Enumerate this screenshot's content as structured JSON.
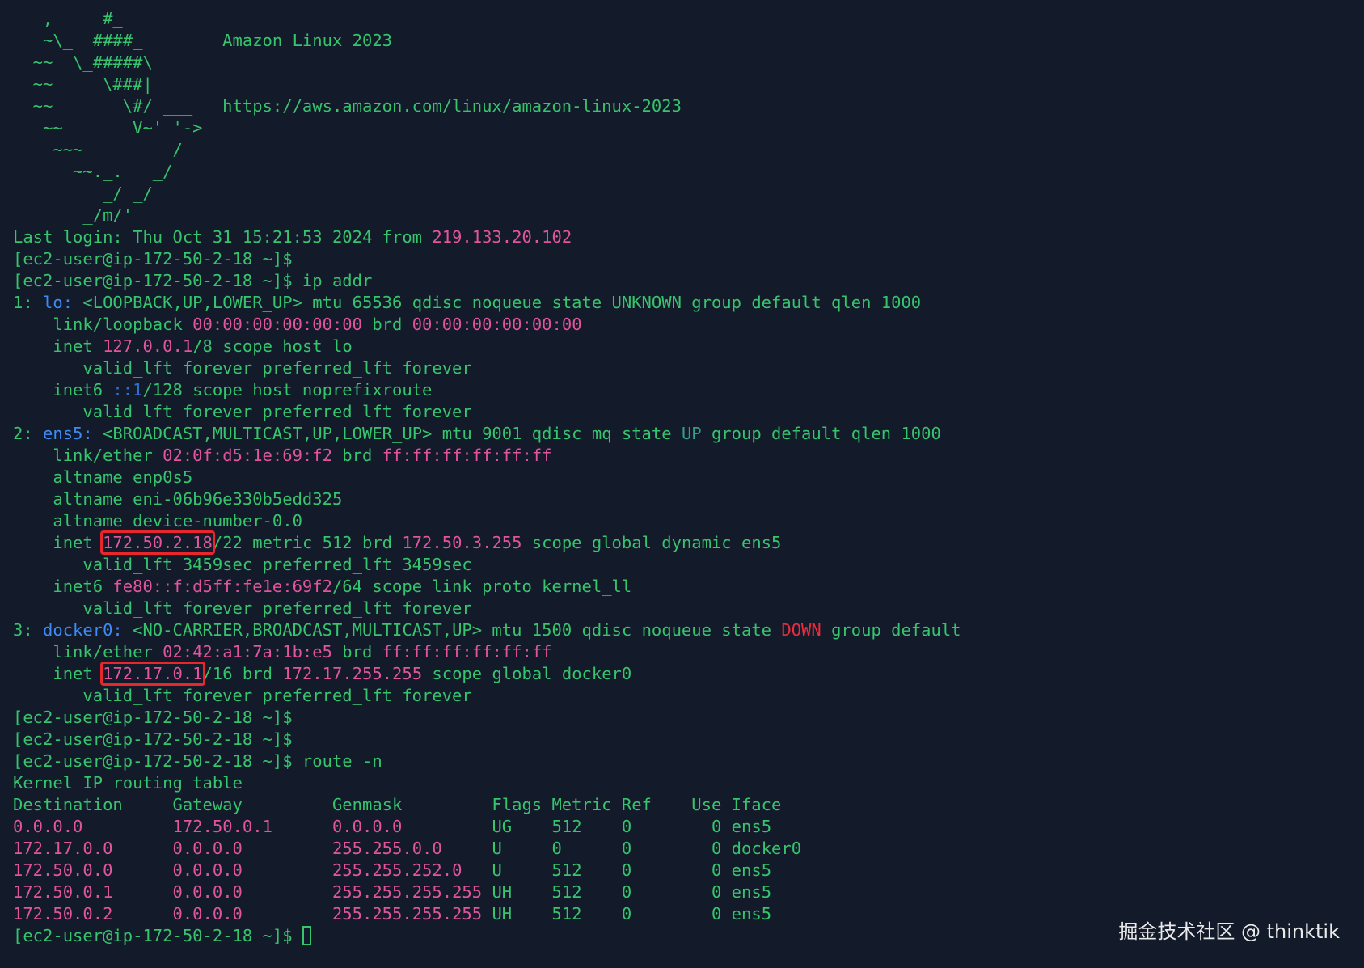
{
  "colors": {
    "background": "#131a2a",
    "text_green": "#36c46d",
    "text_pink": "#e0559b",
    "text_blue": "#3d8bf5",
    "text_red": "#f02a3c",
    "highlight_box": "#e8262b"
  },
  "terminal": {
    "lines": [
      [
        {
          "t": "   ,     #_",
          "c": "g"
        }
      ],
      [
        {
          "t": "   ~\\_  ####_        Amazon Linux 2023",
          "c": "g"
        }
      ],
      [
        {
          "t": "  ~~  \\_#####\\",
          "c": "g"
        }
      ],
      [
        {
          "t": "  ~~     \\###|",
          "c": "g"
        }
      ],
      [
        {
          "t": "  ~~       \\#/ ___   https://aws.amazon.com/linux/amazon-linux-2023",
          "c": "g"
        }
      ],
      [
        {
          "t": "   ~~       V~' '->",
          "c": "g"
        }
      ],
      [
        {
          "t": "    ~~~         /",
          "c": "g"
        }
      ],
      [
        {
          "t": "      ~~._.   _/",
          "c": "g"
        }
      ],
      [
        {
          "t": "         _/ _/",
          "c": "g"
        }
      ],
      [
        {
          "t": "       _/m/'",
          "c": "g"
        }
      ],
      [
        {
          "t": "Last login: Thu Oct 31 15:21:53 2024 from ",
          "c": "g"
        },
        {
          "t": "219.133.20.102",
          "c": "p"
        }
      ],
      [
        {
          "t": "[ec2-user@ip-172-50-2-18 ~]$",
          "c": "g"
        }
      ],
      [
        {
          "t": "[ec2-user@ip-172-50-2-18 ~]$ ip addr",
          "c": "g"
        }
      ],
      [
        {
          "t": "1: ",
          "c": "g"
        },
        {
          "t": "lo:",
          "c": "b"
        },
        {
          "t": " <LOOPBACK,UP,LOWER_UP> mtu 65536 qdisc noqueue state UNKNOWN group default qlen 1000",
          "c": "g"
        }
      ],
      [
        {
          "t": "    link/loopback ",
          "c": "g"
        },
        {
          "t": "00:00:00:00:00:00",
          "c": "p"
        },
        {
          "t": " brd ",
          "c": "g"
        },
        {
          "t": "00:00:00:00:00:00",
          "c": "p"
        }
      ],
      [
        {
          "t": "    inet ",
          "c": "g"
        },
        {
          "t": "127.0.0.1",
          "c": "p"
        },
        {
          "t": "/8 scope host lo",
          "c": "g"
        }
      ],
      [
        {
          "t": "       valid_lft forever preferred_lft forever",
          "c": "g"
        }
      ],
      [
        {
          "t": "    inet6 ",
          "c": "g"
        },
        {
          "t": "::1",
          "c": "k"
        },
        {
          "t": "/128 scope host noprefixroute",
          "c": "g"
        }
      ],
      [
        {
          "t": "       valid_lft forever preferred_lft forever",
          "c": "g"
        }
      ],
      [
        {
          "t": "2: ",
          "c": "g"
        },
        {
          "t": "ens5:",
          "c": "b"
        },
        {
          "t": " <BROADCAST,MULTICAST,UP,LOWER_UP> mtu 9001 qdisc mq state ",
          "c": "g"
        },
        {
          "t": "UP",
          "c": "t"
        },
        {
          "t": " group default qlen 1000",
          "c": "g"
        }
      ],
      [
        {
          "t": "    link/ether ",
          "c": "g"
        },
        {
          "t": "02:0f:d5:1e:69:f2",
          "c": "p"
        },
        {
          "t": " brd ",
          "c": "g"
        },
        {
          "t": "ff:ff:ff:ff:ff:ff",
          "c": "p"
        }
      ],
      [
        {
          "t": "    altname enp0s5",
          "c": "g"
        }
      ],
      [
        {
          "t": "    altname eni-06b96e330b5edd325",
          "c": "g"
        }
      ],
      [
        {
          "t": "    altname device-number-0.0",
          "c": "g"
        }
      ],
      [
        {
          "t": "    inet ",
          "c": "g"
        },
        {
          "t": "172.50.2.18",
          "c": "p",
          "hl": true
        },
        {
          "t": "/22 metric 512 brd ",
          "c": "g"
        },
        {
          "t": "172.50.3.255",
          "c": "p"
        },
        {
          "t": " scope global dynamic ens5",
          "c": "g"
        }
      ],
      [
        {
          "t": "       valid_lft 3459sec preferred_lft 3459sec",
          "c": "g"
        }
      ],
      [
        {
          "t": "    inet6 ",
          "c": "g"
        },
        {
          "t": "fe80::f:d5ff:fe1e:69f2",
          "c": "p"
        },
        {
          "t": "/64 scope link proto kernel_ll",
          "c": "g"
        }
      ],
      [
        {
          "t": "       valid_lft forever preferred_lft forever",
          "c": "g"
        }
      ],
      [
        {
          "t": "3: ",
          "c": "g"
        },
        {
          "t": "docker0:",
          "c": "b"
        },
        {
          "t": " <NO-CARRIER,BROADCAST,MULTICAST,UP> mtu 1500 qdisc noqueue state ",
          "c": "g"
        },
        {
          "t": "DOWN",
          "c": "r"
        },
        {
          "t": " group default",
          "c": "g"
        }
      ],
      [
        {
          "t": "    link/ether ",
          "c": "g"
        },
        {
          "t": "02:42:a1:7a:1b:e5",
          "c": "p"
        },
        {
          "t": " brd ",
          "c": "g"
        },
        {
          "t": "ff:ff:ff:ff:ff:ff",
          "c": "p"
        }
      ],
      [
        {
          "t": "    inet ",
          "c": "g"
        },
        {
          "t": "172.17.0.1",
          "c": "p",
          "hl": true
        },
        {
          "t": "/16 brd ",
          "c": "g"
        },
        {
          "t": "172.17.255.255",
          "c": "p"
        },
        {
          "t": " scope global docker0",
          "c": "g"
        }
      ],
      [
        {
          "t": "       valid_lft forever preferred_lft forever",
          "c": "g"
        }
      ],
      [
        {
          "t": "[ec2-user@ip-172-50-2-18 ~]$",
          "c": "g"
        }
      ],
      [
        {
          "t": "[ec2-user@ip-172-50-2-18 ~]$",
          "c": "g"
        }
      ],
      [
        {
          "t": "[ec2-user@ip-172-50-2-18 ~]$ route -n",
          "c": "g"
        }
      ],
      [
        {
          "t": "Kernel IP routing table",
          "c": "g"
        }
      ],
      [
        {
          "t": "Destination     Gateway         Genmask         Flags Metric Ref    Use Iface",
          "c": "g"
        }
      ],
      [
        {
          "t": "0.0.0.0         ",
          "c": "p"
        },
        {
          "t": "172.50.0.1      ",
          "c": "p"
        },
        {
          "t": "0.0.0.0         ",
          "c": "p"
        },
        {
          "t": "UG    512    0        0 ens5",
          "c": "g"
        }
      ],
      [
        {
          "t": "172.17.0.0      ",
          "c": "p"
        },
        {
          "t": "0.0.0.0         ",
          "c": "p"
        },
        {
          "t": "255.255.0.0     ",
          "c": "p"
        },
        {
          "t": "U     0      0        0 docker0",
          "c": "g"
        }
      ],
      [
        {
          "t": "172.50.0.0      ",
          "c": "p"
        },
        {
          "t": "0.0.0.0         ",
          "c": "p"
        },
        {
          "t": "255.255.252.0   ",
          "c": "p"
        },
        {
          "t": "U     512    0        0 ens5",
          "c": "g"
        }
      ],
      [
        {
          "t": "172.50.0.1      ",
          "c": "p"
        },
        {
          "t": "0.0.0.0         ",
          "c": "p"
        },
        {
          "t": "255.255.255.255 ",
          "c": "p"
        },
        {
          "t": "UH    512    0        0 ens5",
          "c": "g"
        }
      ],
      [
        {
          "t": "172.50.0.2      ",
          "c": "p"
        },
        {
          "t": "0.0.0.0         ",
          "c": "p"
        },
        {
          "t": "255.255.255.255 ",
          "c": "p"
        },
        {
          "t": "UH    512    0        0 ens5",
          "c": "g"
        }
      ]
    ],
    "prompt": "[ec2-user@ip-172-50-2-18 ~]$ ",
    "cursor_icon": "block-cursor-icon"
  },
  "watermark": "掘金技术社区 @ thinktik"
}
